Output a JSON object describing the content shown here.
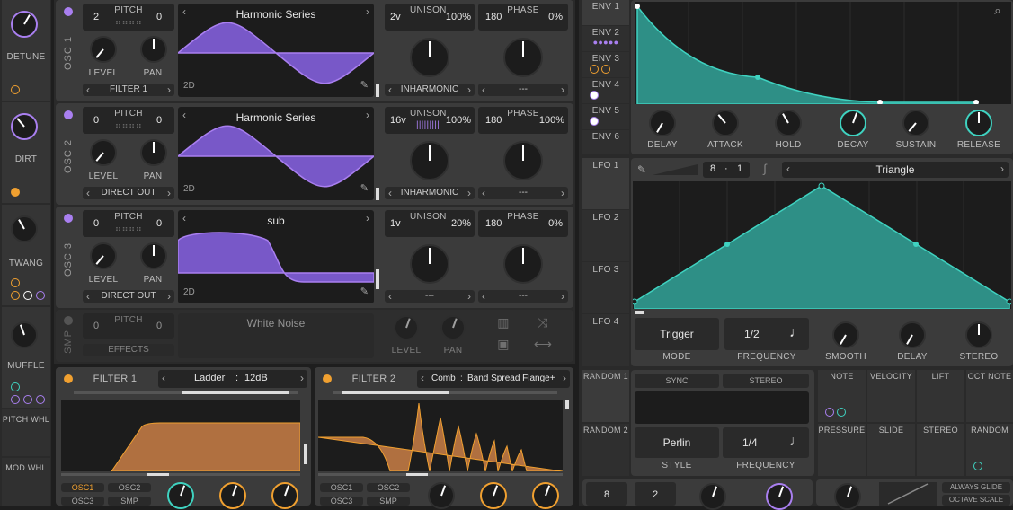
{
  "mods_left": [
    {
      "label": "DETUNE"
    },
    {
      "label": "DIRT"
    },
    {
      "label": "TWANG"
    },
    {
      "label": "MUFFLE"
    },
    {
      "label": "PITCH WHL"
    },
    {
      "label": "MOD WHL"
    }
  ],
  "oscs": [
    {
      "tab": "OSC 1",
      "pitch_label": "PITCH",
      "pitch_left": "2",
      "pitch_right": "0",
      "wave": "Harmonic Series",
      "dim": "2D",
      "level": "LEVEL",
      "pan": "PAN",
      "dest": "FILTER 1",
      "unison_label": "UNISON",
      "unison_voices": "2v",
      "unison_pct": "100%",
      "phase_label": "PHASE",
      "phase_deg": "180",
      "phase_pct": "0%",
      "spectral": "INHARMONIC",
      "phase_mode": "---"
    },
    {
      "tab": "OSC 2",
      "pitch_label": "PITCH",
      "pitch_left": "0",
      "pitch_right": "0",
      "wave": "Harmonic Series",
      "dim": "2D",
      "level": "LEVEL",
      "pan": "PAN",
      "dest": "DIRECT OUT",
      "unison_label": "UNISON",
      "unison_voices": "16v",
      "unison_pct": "100%",
      "phase_label": "PHASE",
      "phase_deg": "180",
      "phase_pct": "100%",
      "spectral": "INHARMONIC",
      "phase_mode": "---"
    },
    {
      "tab": "OSC 3",
      "pitch_label": "PITCH",
      "pitch_left": "0",
      "pitch_right": "0",
      "wave": "sub",
      "dim": "2D",
      "level": "LEVEL",
      "pan": "PAN",
      "dest": "DIRECT OUT",
      "unison_label": "UNISON",
      "unison_voices": "1v",
      "unison_pct": "20%",
      "phase_label": "PHASE",
      "phase_deg": "180",
      "phase_pct": "0%",
      "spectral": "---",
      "phase_mode": "---"
    }
  ],
  "smp": {
    "tab": "SMP",
    "pitch_label": "PITCH",
    "pitch_left": "0",
    "pitch_right": "0",
    "sample": "White Noise",
    "dest": "EFFECTS",
    "level": "LEVEL",
    "pan": "PAN"
  },
  "filters": [
    {
      "title": "FILTER 1",
      "model": "Ladder",
      "type": "12dB",
      "inputs": [
        "OSC1",
        "OSC2",
        "OSC3",
        "SMP"
      ]
    },
    {
      "title": "FILTER 2",
      "model": "Comb",
      "type": "Band Spread Flange+",
      "inputs": [
        "OSC1",
        "OSC2",
        "OSC3",
        "SMP"
      ]
    }
  ],
  "env_tabs": [
    "ENV 1",
    "ENV 2",
    "ENV 3",
    "ENV 4",
    "ENV 5",
    "ENV 6"
  ],
  "env_knobs": [
    "DELAY",
    "ATTACK",
    "HOLD",
    "DECAY",
    "SUSTAIN",
    "RELEASE"
  ],
  "lfo_tabs": [
    "LFO 1",
    "LFO 2",
    "LFO 3",
    "LFO 4"
  ],
  "lfo": {
    "beats": "8",
    "sep": "·",
    "div": "1",
    "shape": "Triangle",
    "mode_value": "Trigger",
    "mode_label": "MODE",
    "freq_value": "1/2",
    "freq_label": "FREQUENCY",
    "smooth": "SMOOTH",
    "delay": "DELAY",
    "stereo": "STEREO"
  },
  "random_tabs": [
    "RANDOM 1",
    "RANDOM 2"
  ],
  "random": {
    "sync": "SYNC",
    "stereo": "STEREO",
    "style_value": "Perlin",
    "style_label": "STYLE",
    "freq_value": "1/4",
    "freq_label": "FREQUENCY"
  },
  "sources": [
    "NOTE",
    "VELOCITY",
    "LIFT",
    "OCT NOTE",
    "PRESSURE",
    "SLIDE",
    "STEREO",
    "RANDOM"
  ],
  "bottom": {
    "voices": "8",
    "bend": "2",
    "glide": "ALWAYS GLIDE",
    "octave": "OCTAVE SCALE"
  },
  "colors": {
    "accent_purple": "#a97ff0",
    "accent_teal": "#3fd2c0",
    "accent_orange": "#f0a030"
  }
}
